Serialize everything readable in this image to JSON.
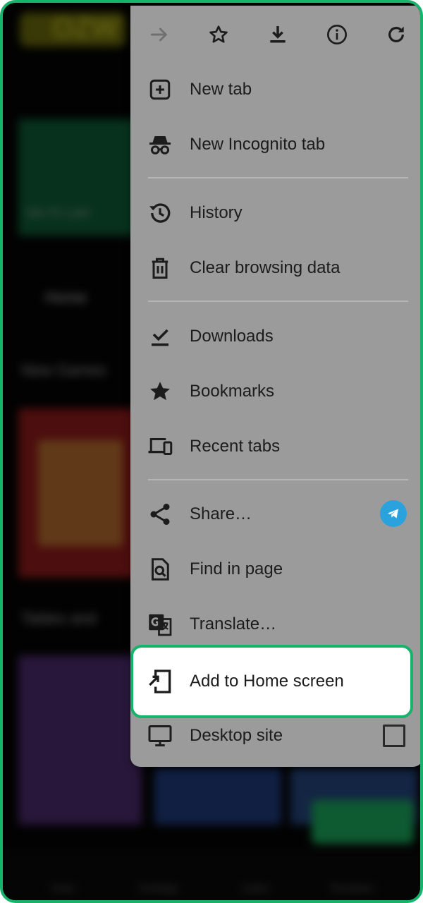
{
  "background_page": {
    "logo_text": "OZW",
    "banner_text": "Win ₹1 Lakh",
    "nav_label": "Home",
    "section_1": "New Games",
    "section_2": "Tables and",
    "bottom_nav": [
      "Home",
      "Exchange",
      "Casino",
      "Promotions"
    ]
  },
  "menu": {
    "toolbar": {
      "forward": "forward-icon",
      "bookmark": "star-outline-icon",
      "download": "download-icon",
      "info": "info-icon",
      "refresh": "refresh-icon"
    },
    "items": {
      "new_tab": "New tab",
      "new_incognito_tab": "New Incognito tab",
      "history": "History",
      "clear_browsing_data": "Clear browsing data",
      "downloads": "Downloads",
      "bookmarks": "Bookmarks",
      "recent_tabs": "Recent tabs",
      "share": "Share…",
      "find_in_page": "Find in page",
      "translate": "Translate…",
      "add_to_home_screen": "Add to Home screen",
      "desktop_site": "Desktop site"
    },
    "desktop_site_checked": false
  },
  "colors": {
    "highlight_border": "#17b36b",
    "menu_bg": "#9b9b9b",
    "telegram": "#2aa2dd"
  }
}
